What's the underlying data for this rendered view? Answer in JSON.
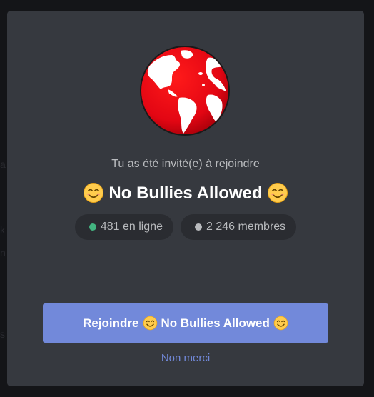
{
  "invite": {
    "subtitle": "Tu as été invité(e) à rejoindre",
    "server_name": "No Bullies Allowed",
    "online_count": "481 en ligne",
    "member_count": "2 246 membres",
    "join_label_prefix": "Rejoindre",
    "decline_label": "Non merci",
    "server_icon": "globe-icon",
    "name_emoji": "smiling-face-emoji"
  },
  "colors": {
    "modal_bg": "#36393f",
    "accent": "#7289da",
    "online_dot": "#43b581",
    "members_dot": "#b9bbbe",
    "globe_red": "#e30613"
  }
}
